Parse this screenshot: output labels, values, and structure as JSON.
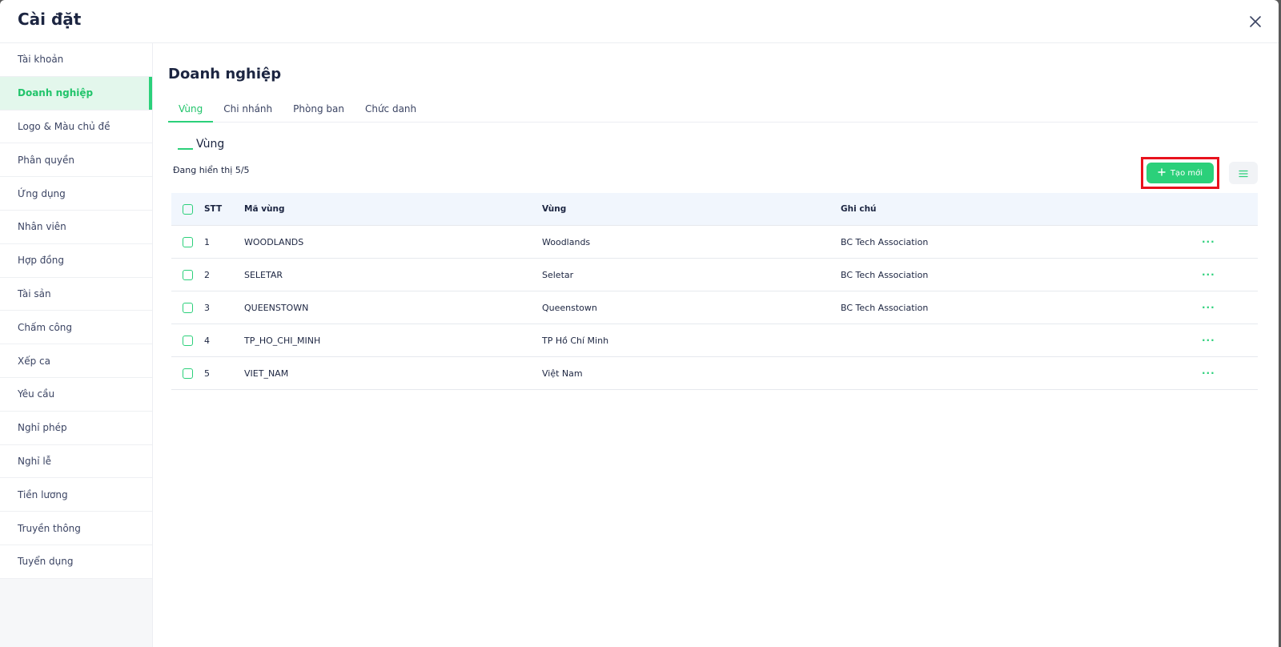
{
  "modal": {
    "title": "Cài đặt"
  },
  "sidebar": {
    "items": [
      {
        "label": "Tài khoản"
      },
      {
        "label": "Doanh nghiệp",
        "active": true
      },
      {
        "label": "Logo & Màu chủ đề"
      },
      {
        "label": "Phân quyền"
      },
      {
        "label": "Ứng dụng"
      },
      {
        "label": "Nhân viên"
      },
      {
        "label": "Hợp đồng"
      },
      {
        "label": "Tài sản"
      },
      {
        "label": "Chấm công"
      },
      {
        "label": "Xếp ca"
      },
      {
        "label": "Yêu cầu"
      },
      {
        "label": "Nghỉ phép"
      },
      {
        "label": "Nghỉ lễ"
      },
      {
        "label": "Tiền lương"
      },
      {
        "label": "Truyền thông"
      },
      {
        "label": "Tuyển dụng"
      }
    ]
  },
  "main": {
    "title": "Doanh nghiệp",
    "tabs": [
      {
        "label": "Vùng",
        "active": true
      },
      {
        "label": "Chi nhánh"
      },
      {
        "label": "Phòng ban"
      },
      {
        "label": "Chức danh"
      }
    ],
    "section_title": "Vùng",
    "count_text": "Đang hiển thị 5/5",
    "new_button_label": "Tạo mới",
    "table": {
      "headers": {
        "stt": "STT",
        "code": "Mã vùng",
        "region": "Vùng",
        "note": "Ghi chú"
      },
      "rows": [
        {
          "stt": "1",
          "code": "WOODLANDS",
          "region": "Woodlands",
          "note": "BC Tech Association"
        },
        {
          "stt": "2",
          "code": "SELETAR",
          "region": "Seletar",
          "note": "BC Tech Association"
        },
        {
          "stt": "3",
          "code": "QUEENSTOWN",
          "region": "Queenstown",
          "note": "BC Tech Association"
        },
        {
          "stt": "4",
          "code": "TP_HO_CHI_MINH",
          "region": "TP Hồ Chí Minh",
          "note": ""
        },
        {
          "stt": "5",
          "code": "VIET_NAM",
          "region": "Việt Nam",
          "note": ""
        }
      ],
      "row_action_label": "···"
    }
  },
  "colors": {
    "accent": "#2bd07a",
    "highlight": "#e8121d",
    "text": "#1c2541"
  }
}
